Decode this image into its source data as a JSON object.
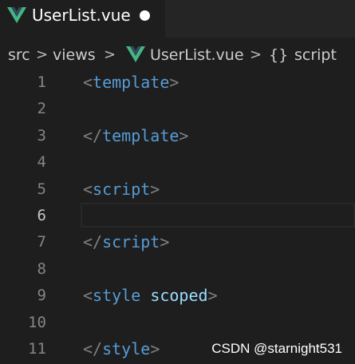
{
  "tab": {
    "title": "UserList.vue",
    "icon": "vue-logo-icon",
    "modified": true
  },
  "breadcrumb": {
    "items": [
      "src",
      "views",
      "UserList.vue",
      "script"
    ],
    "symbol_icon": "{}",
    "separator": ">"
  },
  "editor": {
    "current_line": 6,
    "lines": [
      {
        "num": "1",
        "tokens": [
          [
            "<",
            "punct"
          ],
          [
            "template",
            "tag"
          ],
          [
            ">",
            "punct"
          ]
        ]
      },
      {
        "num": "2",
        "tokens": []
      },
      {
        "num": "3",
        "tokens": [
          [
            "</",
            "punct"
          ],
          [
            "template",
            "tag"
          ],
          [
            ">",
            "punct"
          ]
        ]
      },
      {
        "num": "4",
        "tokens": []
      },
      {
        "num": "5",
        "tokens": [
          [
            "<",
            "punct"
          ],
          [
            "script",
            "tag"
          ],
          [
            ">",
            "punct"
          ]
        ]
      },
      {
        "num": "6",
        "tokens": []
      },
      {
        "num": "7",
        "tokens": [
          [
            "</",
            "punct"
          ],
          [
            "script",
            "tag"
          ],
          [
            ">",
            "punct"
          ]
        ]
      },
      {
        "num": "8",
        "tokens": []
      },
      {
        "num": "9",
        "tokens": [
          [
            "<",
            "punct"
          ],
          [
            "style",
            "tag"
          ],
          [
            " ",
            "punct"
          ],
          [
            "scoped",
            "attr"
          ],
          [
            ">",
            "punct"
          ]
        ]
      },
      {
        "num": "10",
        "tokens": []
      },
      {
        "num": "11",
        "tokens": [
          [
            "</",
            "punct"
          ],
          [
            "style",
            "tag"
          ],
          [
            ">",
            "punct"
          ]
        ]
      }
    ]
  },
  "watermark": "CSDN @starnight531",
  "colors": {
    "vue_green": "#41b883",
    "vue_dark": "#35495e",
    "tag": "#569cd6",
    "attr": "#9cdcfe",
    "punct": "#808080"
  }
}
